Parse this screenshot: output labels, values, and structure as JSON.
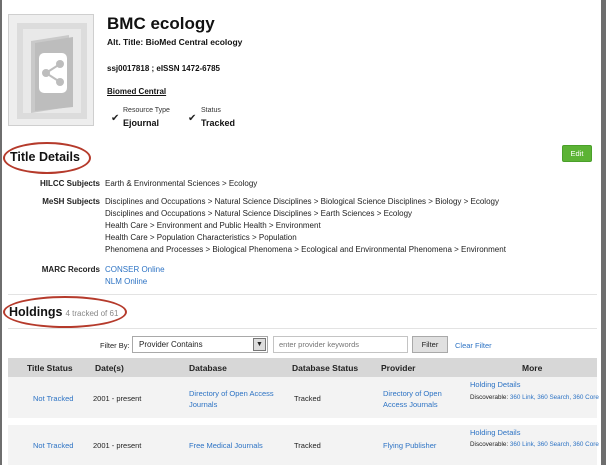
{
  "header": {
    "title": "BMC ecology",
    "alt_title": "Alt. Title: BioMed Central ecology",
    "issn": "ssj0017818 ; eISSN 1472-6785",
    "publisher": "Biomed Central",
    "resource_type_label": "Resource Type",
    "resource_type_value": "Ejournal",
    "status_label": "Status",
    "status_value": "Tracked"
  },
  "title_details": {
    "heading": "Title Details",
    "edit_label": "Edit",
    "hilcc_label": "HILCC Subjects",
    "hilcc_subjects": [
      "Earth & Environmental Sciences > Ecology"
    ],
    "mesh_label": "MeSH Subjects",
    "mesh_subjects": [
      "Disciplines and Occupations > Natural Science Disciplines > Biological Science Disciplines > Biology > Ecology",
      "Disciplines and Occupations > Natural Science Disciplines > Earth Sciences > Ecology",
      "Health Care > Environment and Public Health > Environment",
      "Health Care > Population Characteristics > Population",
      "Phenomena and Processes > Biological Phenomena > Ecological and Environmental Phenomena > Environment"
    ],
    "marc_label": "MARC Records",
    "marc_records": [
      "CONSER Online",
      "NLM Online"
    ]
  },
  "holdings": {
    "heading": "Holdings",
    "count_text": "4 tracked of 61",
    "filter_by_label": "Filter By:",
    "filter_select_value": "Provider Contains",
    "filter_placeholder": "enter provider keywords",
    "filter_button": "Filter",
    "clear_filter": "Clear Filter",
    "columns": [
      "Title Status",
      "Date(s)",
      "Database",
      "Database Status",
      "Provider",
      "More"
    ],
    "rows": [
      {
        "title_status": "Not Tracked",
        "dates": "2001 - present",
        "database": "Directory of Open Access Journals",
        "database_status": "Tracked",
        "provider": "Directory of Open Access Journals",
        "holding_details": "Holding Details",
        "discoverable_label": "Discoverable:",
        "discoverable_links": "360 Link, 360 Search, 360 Core"
      },
      {
        "title_status": "Not Tracked",
        "dates": "2001 - present",
        "database": "Free Medical Journals",
        "database_status": "Tracked",
        "provider": "Flying Publisher",
        "holding_details": "Holding Details",
        "discoverable_label": "Discoverable:",
        "discoverable_links": "360 Link, 360 Search, 360 Core"
      }
    ]
  },
  "colors": {
    "accent_link": "#2d73c4",
    "edit_green": "#5cb335",
    "annotation_red": "#b53a2b"
  }
}
